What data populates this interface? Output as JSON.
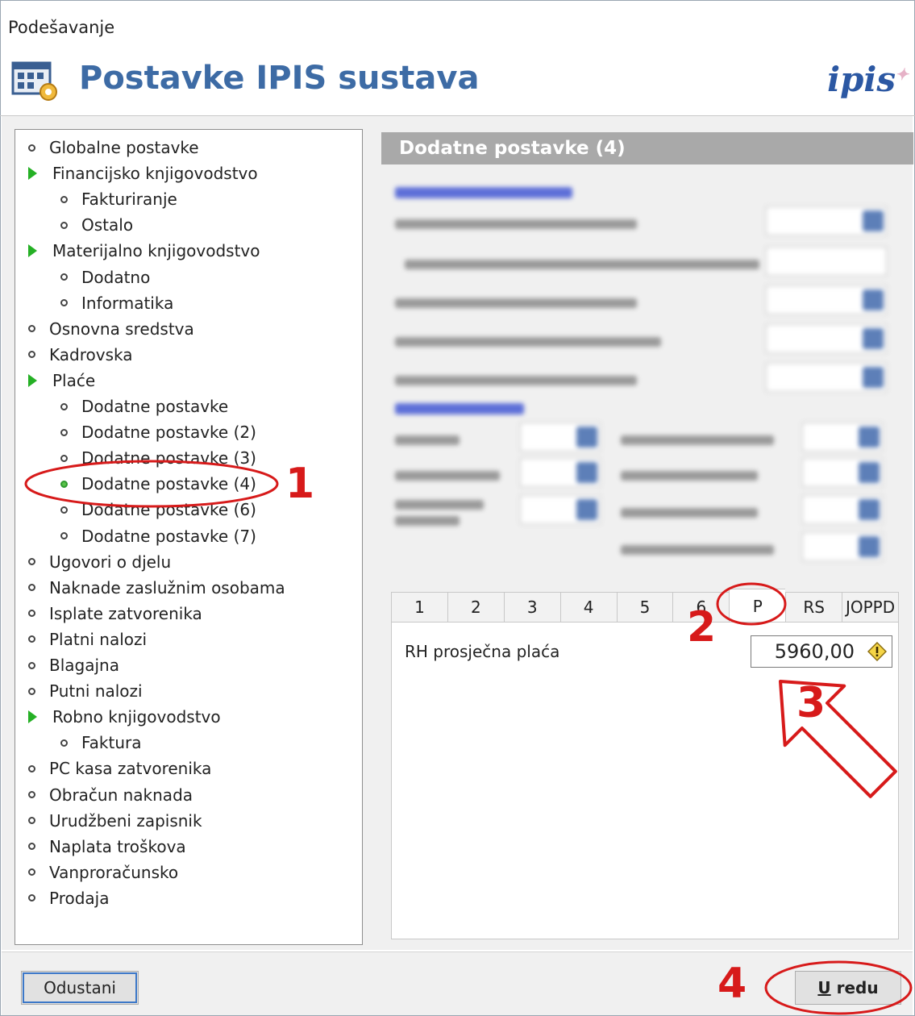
{
  "window": {
    "title": "Podešavanje"
  },
  "header": {
    "title": "Postavke IPIS sustava",
    "logo_text": "ipis",
    "logo_star": "✦"
  },
  "tree": {
    "items": [
      {
        "label": "Globalne postavke",
        "level": 0,
        "kind": "bullet"
      },
      {
        "label": "Financijsko knjigovodstvo",
        "level": 0,
        "kind": "expand"
      },
      {
        "label": "Fakturiranje",
        "level": 1,
        "kind": "bullet"
      },
      {
        "label": "Ostalo",
        "level": 1,
        "kind": "bullet"
      },
      {
        "label": "Materijalno knjigovodstvo",
        "level": 0,
        "kind": "expand"
      },
      {
        "label": "Dodatno",
        "level": 1,
        "kind": "bullet"
      },
      {
        "label": "Informatika",
        "level": 1,
        "kind": "bullet"
      },
      {
        "label": "Osnovna sredstva",
        "level": 0,
        "kind": "bullet"
      },
      {
        "label": "Kadrovska",
        "level": 0,
        "kind": "bullet"
      },
      {
        "label": "Plaće",
        "level": 0,
        "kind": "expand"
      },
      {
        "label": "Dodatne postavke",
        "level": 1,
        "kind": "bullet"
      },
      {
        "label": "Dodatne postavke (2)",
        "level": 1,
        "kind": "bullet"
      },
      {
        "label": "Dodatne postavke (3)",
        "level": 1,
        "kind": "bullet"
      },
      {
        "label": "Dodatne postavke (4)",
        "level": 1,
        "kind": "bullet",
        "selected": true
      },
      {
        "label": "Dodatne postavke (6)",
        "level": 1,
        "kind": "bullet"
      },
      {
        "label": "Dodatne postavke (7)",
        "level": 1,
        "kind": "bullet"
      },
      {
        "label": "Ugovori o djelu",
        "level": 0,
        "kind": "bullet"
      },
      {
        "label": "Naknade zaslužnim osobama",
        "level": 0,
        "kind": "bullet"
      },
      {
        "label": "Isplate zatvorenika",
        "level": 0,
        "kind": "bullet"
      },
      {
        "label": "Platni nalozi",
        "level": 0,
        "kind": "bullet"
      },
      {
        "label": "Blagajna",
        "level": 0,
        "kind": "bullet"
      },
      {
        "label": "Putni nalozi",
        "level": 0,
        "kind": "bullet"
      },
      {
        "label": "Robno knjigovodstvo",
        "level": 0,
        "kind": "expand"
      },
      {
        "label": "Faktura",
        "level": 1,
        "kind": "bullet"
      },
      {
        "label": "PC kasa zatvorenika",
        "level": 0,
        "kind": "bullet"
      },
      {
        "label": "Obračun naknada",
        "level": 0,
        "kind": "bullet"
      },
      {
        "label": "Urudžbeni zapisnik",
        "level": 0,
        "kind": "bullet"
      },
      {
        "label": "Naplata troškova",
        "level": 0,
        "kind": "bullet"
      },
      {
        "label": "Vanproračunsko",
        "level": 0,
        "kind": "bullet"
      },
      {
        "label": "Prodaja",
        "level": 0,
        "kind": "bullet"
      }
    ]
  },
  "panel": {
    "title": "Dodatne postavke (4)",
    "tabs": [
      "1",
      "2",
      "3",
      "4",
      "5",
      "6",
      "P",
      "RS",
      "JOPPD"
    ],
    "active_tab": "P",
    "field": {
      "label": "RH prosječna plaća",
      "value": "5960,00"
    }
  },
  "buttons": {
    "cancel": "Odustani",
    "ok_mnemonic": "U",
    "ok_rest": " redu"
  },
  "annotations": {
    "step1": "1",
    "step2": "2",
    "step3": "3",
    "step4": "4"
  },
  "colors": {
    "title_blue": "#3d6ba5",
    "annotation_red": "#d71a1a",
    "tree_arrow_green": "#25b025",
    "panel_header_grey": "#a9a9a9"
  }
}
